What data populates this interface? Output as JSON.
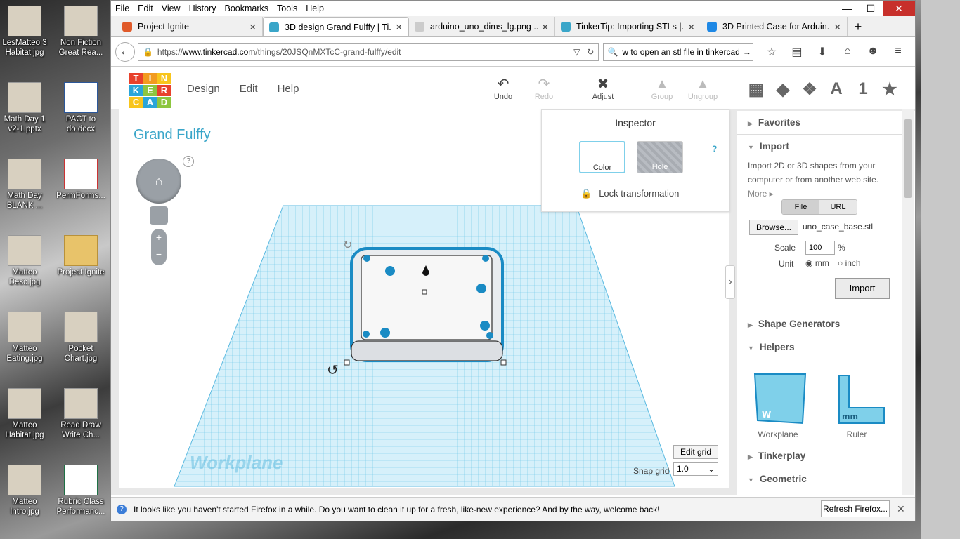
{
  "desktop": {
    "icons": [
      {
        "label": "LesMatteo 3 Habitat.jpg",
        "kind": "photo"
      },
      {
        "label": "Non Fiction Great Rea...",
        "kind": "photo"
      },
      {
        "label": "Math Day 1 v2-1.pptx",
        "kind": "photo"
      },
      {
        "label": "PACT to do.docx",
        "kind": "doc"
      },
      {
        "label": "Math Day BLANK ...",
        "kind": "photo"
      },
      {
        "label": "PermForms...",
        "kind": "pdf"
      },
      {
        "label": "Matteo Desc.jpg",
        "kind": "photo"
      },
      {
        "label": "Project Ignite",
        "kind": "folder"
      },
      {
        "label": "Matteo Eating.jpg",
        "kind": "photo"
      },
      {
        "label": "Pocket Chart.jpg",
        "kind": "photo"
      },
      {
        "label": "Matteo Habitat.jpg",
        "kind": "photo"
      },
      {
        "label": "Read Draw Write Ch...",
        "kind": "photo"
      },
      {
        "label": "Matteo Intro.jpg",
        "kind": "photo"
      },
      {
        "label": "Rubric Class Performanc...",
        "kind": "xls"
      }
    ]
  },
  "browser": {
    "menu": [
      "File",
      "Edit",
      "View",
      "History",
      "Bookmarks",
      "Tools",
      "Help"
    ],
    "window_controls": {
      "minimize": "—",
      "maximize": "☐",
      "close": "✕"
    },
    "tabs": [
      {
        "label": "Project Ignite",
        "icon": "project-ignite-favicon",
        "color": "#e05a2a",
        "active": false
      },
      {
        "label": "3D design Grand Fulffy | Ti...",
        "icon": "tinkercad-favicon",
        "color": "#3aa6c9",
        "active": true
      },
      {
        "label": "arduino_uno_dims_lg.png ...",
        "icon": "image-favicon",
        "color": "#cccccc",
        "active": false
      },
      {
        "label": "TinkerTip: Importing STLs |...",
        "icon": "tinkercad-favicon",
        "color": "#3aa6c9",
        "active": false
      },
      {
        "label": "3D Printed Case for Arduin...",
        "icon": "instructables-favicon",
        "color": "#1e88e5",
        "active": false
      }
    ],
    "new_tab": "+",
    "url_prefix": "https://",
    "url_host": "www.tinkercad.com",
    "url_path": "/things/20JSQnMXTcC-grand-fulffy/edit",
    "search": "w to open an stl file in tinkercad"
  },
  "tinkercad": {
    "logo": [
      "T",
      "I",
      "N",
      "K",
      "E",
      "R",
      "C",
      "A",
      "D"
    ],
    "logo_colors": [
      "#e8412c",
      "#f29b1f",
      "#f8c51c",
      "#2aa5d9",
      "#8dc63f",
      "#e8412c",
      "#f8c51c",
      "#2aa5d9",
      "#8dc63f"
    ],
    "nav": [
      "Design",
      "Edit",
      "Help"
    ],
    "tools": {
      "undo": "Undo",
      "redo": "Redo",
      "adjust": "Adjust",
      "group": "Group",
      "ungroup": "Ungroup"
    },
    "right_tools": [
      "grid",
      "box",
      "shapes",
      "A",
      "1",
      "★"
    ],
    "project_title": "Grand Fulffy",
    "help": "?",
    "inspector": {
      "title": "Inspector",
      "color_label": "Color",
      "hole_label": "Hole",
      "help": "?",
      "lock_label": "Lock transformation"
    },
    "workplane_label": "Workplane",
    "edit_grid": "Edit grid",
    "snap_grid_label": "Snap grid",
    "snap_grid_value": "1.0",
    "panel": {
      "favorites": "Favorites",
      "import": "Import",
      "import_desc": "Import 2D or 3D shapes from your computer or from another web site.",
      "more": "More",
      "file_tab": "File",
      "url_tab": "URL",
      "browse": "Browse...",
      "filename": "uno_case_base.stl",
      "scale_label": "Scale",
      "scale_value": "100",
      "percent": "%",
      "unit_label": "Unit",
      "unit_mm": "mm",
      "unit_inch": "inch",
      "import_button": "Import",
      "shape_generators": "Shape Generators",
      "helpers": "Helpers",
      "helper_workplane": "Workplane",
      "helper_ruler": "Ruler",
      "tinkerplay": "Tinkerplay",
      "geometric": "Geometric"
    }
  },
  "notification": {
    "text": "It looks like you haven't started Firefox in a while. Do you want to clean it up for a fresh, like-new experience? And by the way, welcome back!",
    "button": "Refresh Firefox..."
  }
}
